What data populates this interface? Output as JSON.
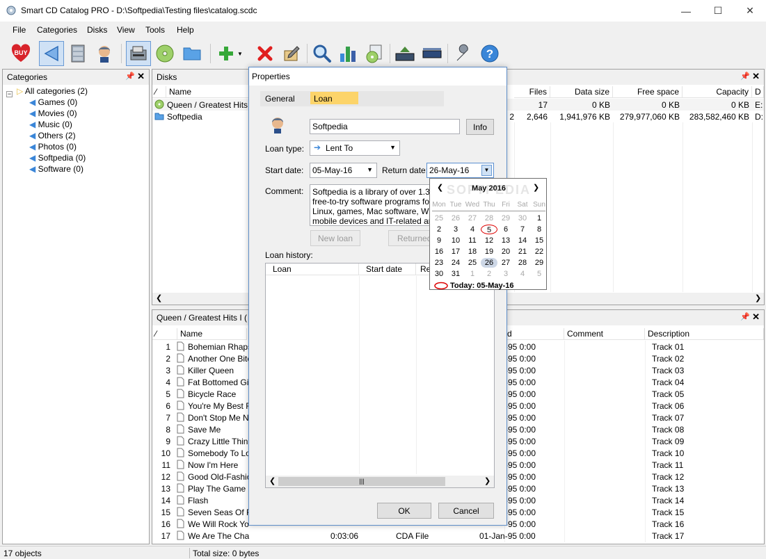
{
  "window": {
    "title": "Smart CD Catalog PRO - D:\\Softpedia\\Testing files\\catalog.scdc",
    "min": "—",
    "max": "☐",
    "close": "✕"
  },
  "menu": [
    "File",
    "Categories",
    "Disks",
    "View",
    "Tools",
    "Help"
  ],
  "toolbar": {
    "buy_label": "BUY"
  },
  "categories_panel": {
    "title": "Categories",
    "root": "All categories (2)",
    "items": [
      "Games (0)",
      "Movies (0)",
      "Music (0)",
      "Others (2)",
      "Photos (0)",
      "Softpedia (0)",
      "Software (0)"
    ]
  },
  "disks_panel": {
    "title": "Disks",
    "columns": [
      "Name",
      "Files",
      "Data size",
      "Free space",
      "Capacity",
      "D"
    ],
    "rows": [
      {
        "name": "Queen / Greatest Hits I (",
        "files": "17",
        "data_size": "0 KB",
        "free": "0 KB",
        "capacity": "0 KB",
        "d": "E:",
        "num": ""
      },
      {
        "name": "Softpedia",
        "num": "2",
        "files": "2,646",
        "data_size": "1,941,976 KB",
        "free": "279,977,060 KB",
        "capacity": "283,582,460 KB",
        "d": "D:"
      }
    ]
  },
  "tracks_panel": {
    "title": "Queen / Greatest Hits I (",
    "columns": [
      "Name",
      "d",
      "Comment",
      "Description"
    ],
    "rows": [
      {
        "n": "1",
        "name": "Bohemian Rhapso",
        "date": "-95 0:00",
        "desc": "Track 01"
      },
      {
        "n": "2",
        "name": "Another One Bites",
        "date": "-95 0:00",
        "desc": "Track 02"
      },
      {
        "n": "3",
        "name": "Killer Queen",
        "date": "-95 0:00",
        "desc": "Track 03"
      },
      {
        "n": "4",
        "name": "Fat Bottomed Girls",
        "date": "-95 0:00",
        "desc": "Track 04"
      },
      {
        "n": "5",
        "name": "Bicycle Race",
        "date": "-95 0:00",
        "desc": "Track 05"
      },
      {
        "n": "6",
        "name": "You're My Best Frie",
        "date": "-95 0:00",
        "desc": "Track 06"
      },
      {
        "n": "7",
        "name": "Don't Stop Me Now",
        "date": "-95 0:00",
        "desc": "Track 07"
      },
      {
        "n": "8",
        "name": "Save Me",
        "date": "-95 0:00",
        "desc": "Track 08"
      },
      {
        "n": "9",
        "name": "Crazy Little Thing C",
        "date": "-95 0:00",
        "desc": "Track 09"
      },
      {
        "n": "10",
        "name": "Somebody To Love",
        "date": "-95 0:00",
        "desc": "Track 10"
      },
      {
        "n": "11",
        "name": "Now I'm Here",
        "date": "-95 0:00",
        "desc": "Track 11"
      },
      {
        "n": "12",
        "name": "Good Old-Fashione",
        "date": "-95 0:00",
        "desc": "Track 12"
      },
      {
        "n": "13",
        "name": "Play The Game",
        "date": "-95 0:00",
        "desc": "Track 13"
      },
      {
        "n": "14",
        "name": "Flash",
        "date": "-95 0:00",
        "desc": "Track 14"
      },
      {
        "n": "15",
        "name": "Seven Seas Of Rhy",
        "date": "-95 0:00",
        "desc": "Track 15"
      },
      {
        "n": "16",
        "name": "We Will Rock You",
        "date": "-95 0:00",
        "desc": "Track 16"
      },
      {
        "n": "17",
        "name": "We Are The Champions",
        "dur": "0:03:06",
        "type": "CDA File",
        "date": "01-Jan-95 0:00",
        "desc": "Track 17"
      }
    ]
  },
  "dialog": {
    "title": "Properties",
    "tab_general": "General",
    "tab_loan": "Loan",
    "person": "Softpedia",
    "info_button": "Info",
    "loan_type_label": "Loan type:",
    "loan_type": "Lent To",
    "start_label": "Start date:",
    "start_date": "05-May-16",
    "return_label": "Return date:",
    "return_date": "26-May-16",
    "comment_label": "Comment:",
    "comment_lines": [
      "Softpedia is a library of over 1.300.0",
      "free-to-try software programs for Win",
      "Linux, games, Mac software, Windo",
      "mobile devices and IT-related article"
    ],
    "new_loan": "New loan",
    "returned": "Returned",
    "history_label": "Loan history:",
    "history_cols": [
      "Loan",
      "Start date",
      "Re"
    ],
    "ok": "OK",
    "cancel": "Cancel"
  },
  "calendar": {
    "month": "May 2016",
    "weekdays": [
      "Mon",
      "Tue",
      "Wed",
      "Thu",
      "Fri",
      "Sat",
      "Sun"
    ],
    "weeks": [
      [
        "25",
        "26",
        "27",
        "28",
        "29",
        "30",
        "1"
      ],
      [
        "2",
        "3",
        "4",
        "5",
        "6",
        "7",
        "8"
      ],
      [
        "9",
        "10",
        "11",
        "12",
        "13",
        "14",
        "15"
      ],
      [
        "16",
        "17",
        "18",
        "19",
        "20",
        "21",
        "22"
      ],
      [
        "23",
        "24",
        "25",
        "26",
        "27",
        "28",
        "29"
      ],
      [
        "30",
        "31",
        "1",
        "2",
        "3",
        "4",
        "5"
      ]
    ],
    "today": "Today: 05-May-16",
    "watermark": "SOFTPEDIA"
  },
  "status": {
    "objects": "17 objects",
    "total": "Total size: 0 bytes"
  }
}
